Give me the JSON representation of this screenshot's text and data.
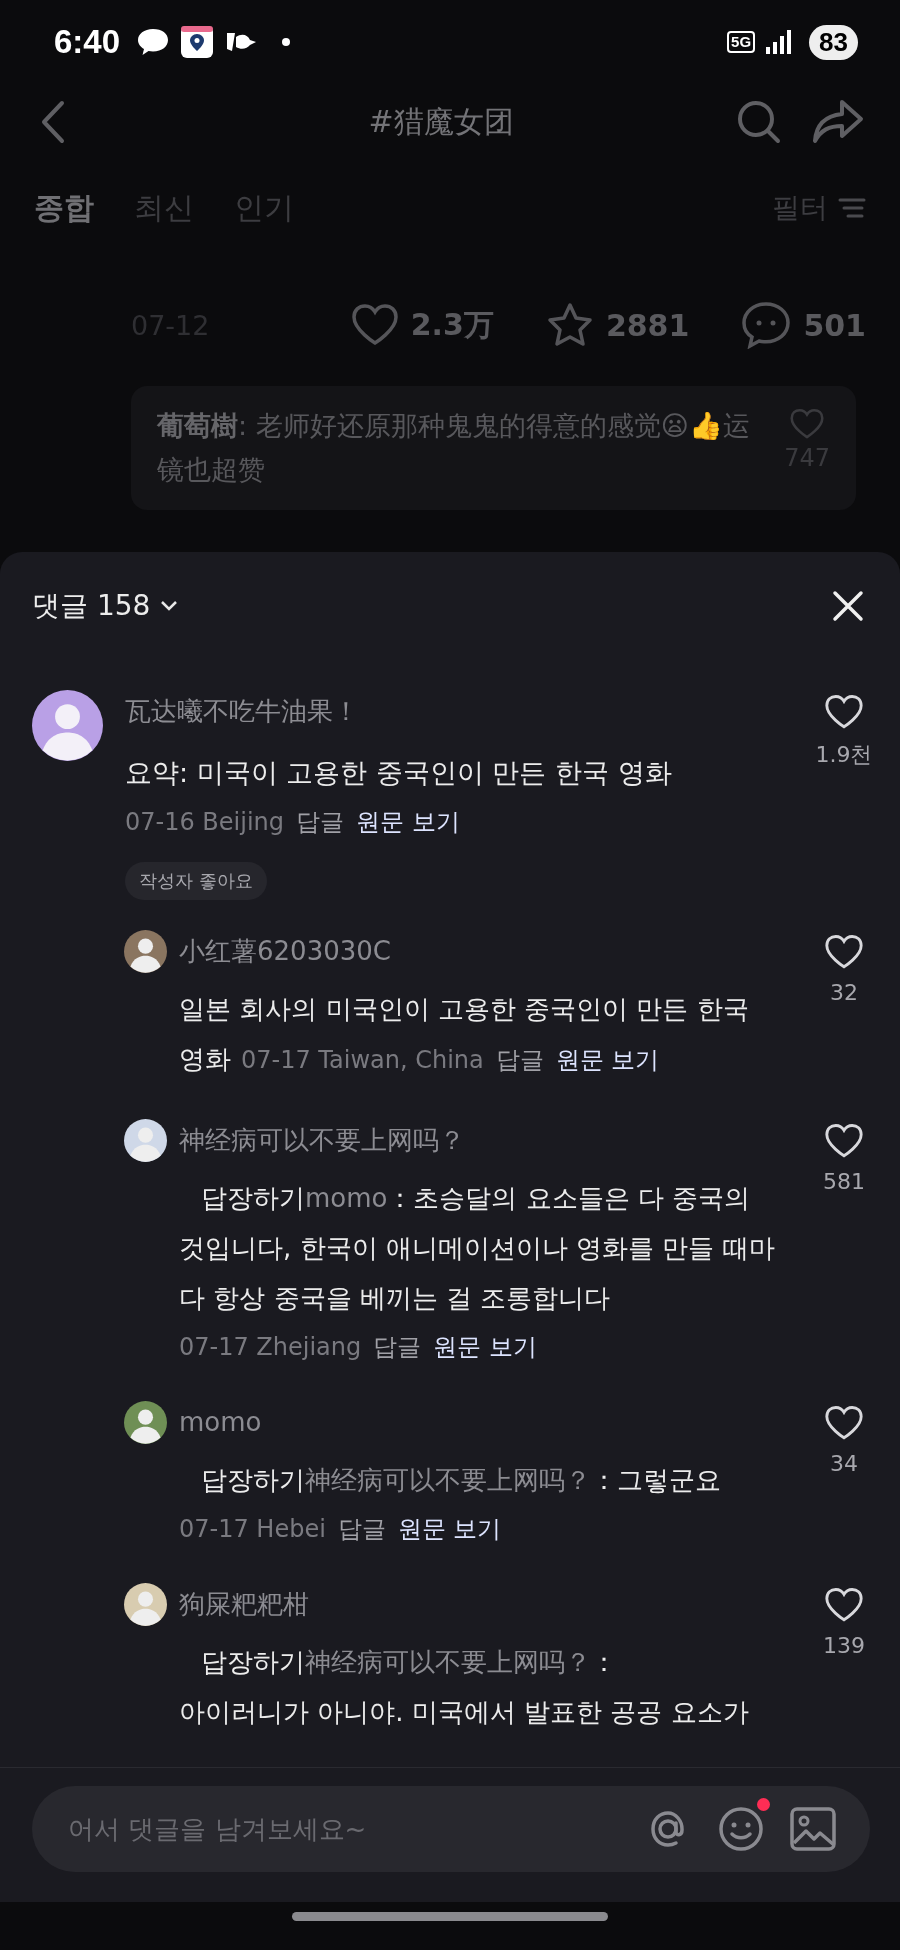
{
  "status_bar": {
    "time": "6:40",
    "network": "5G",
    "battery": "83"
  },
  "header": {
    "title": "#猎魔女团"
  },
  "tabs": [
    {
      "label": "종합",
      "selected": true
    },
    {
      "label": "최신",
      "selected": false
    },
    {
      "label": "인기",
      "selected": false
    }
  ],
  "filter": {
    "label": "필터"
  },
  "post": {
    "date": "07-12",
    "likes": "2.3万",
    "favorites": "2881",
    "comments": "501"
  },
  "top_comment": {
    "author": "葡萄樹",
    "text": ": 老师好还原那种鬼鬼的得意的感觉😦👍运镜也超赞",
    "likes": "747"
  },
  "comment_sheet": {
    "title": "댓글 158",
    "comments": [
      {
        "author": "瓦达曦不吃牛油果！",
        "text": "요약: 미국이 고용한 중국인이 만든 한국 영화",
        "date_location": "07-16 Beijing",
        "reply_label": "답글",
        "view_original": "원문 보기",
        "likes": "1.9천",
        "badge": "작성자 좋아요",
        "replies": [
          {
            "author": "小红薯6203030C",
            "text": "일본 회사의 미국인이 고용한 중국인이 만든 한국 영화",
            "meta_inline": true,
            "date_location": "07-17 Taiwan, China",
            "reply_label": "답글",
            "view_original": "원문 보기",
            "likes": "32"
          },
          {
            "author": "神经病可以不要上网吗？",
            "reply_prefix": "답장하기",
            "reply_to": "momo",
            "text": "：초승달의 요소들은 다 중국의 것입니다, 한국이 애니메이션이나 영화를 만들 때마다 항상 중국을 베끼는 걸 조롱합니다",
            "meta_inline": false,
            "date_location": "07-17 Zhejiang",
            "reply_label": "답글",
            "view_original": "원문 보기",
            "likes": "581"
          },
          {
            "author": "momo",
            "reply_prefix": "답장하기",
            "reply_to": "神经病可以不要上网吗？",
            "text": "：그렇군요",
            "meta_inline": false,
            "date_location": "07-17 Hebei",
            "reply_label": "답글",
            "view_original": "원문 보기",
            "likes": "34"
          },
          {
            "author": "狗屎粑粑柑",
            "reply_prefix": "답장하기",
            "reply_to": "神经病可以不要上网吗？",
            "text": "：\n아이러니가 아니야. 미국에서 발표한 공공 요소가",
            "likes": "139"
          }
        ]
      }
    ],
    "input": {
      "placeholder": "어서 댓글을 남겨보세요~",
      "emoji_notification": true
    }
  }
}
